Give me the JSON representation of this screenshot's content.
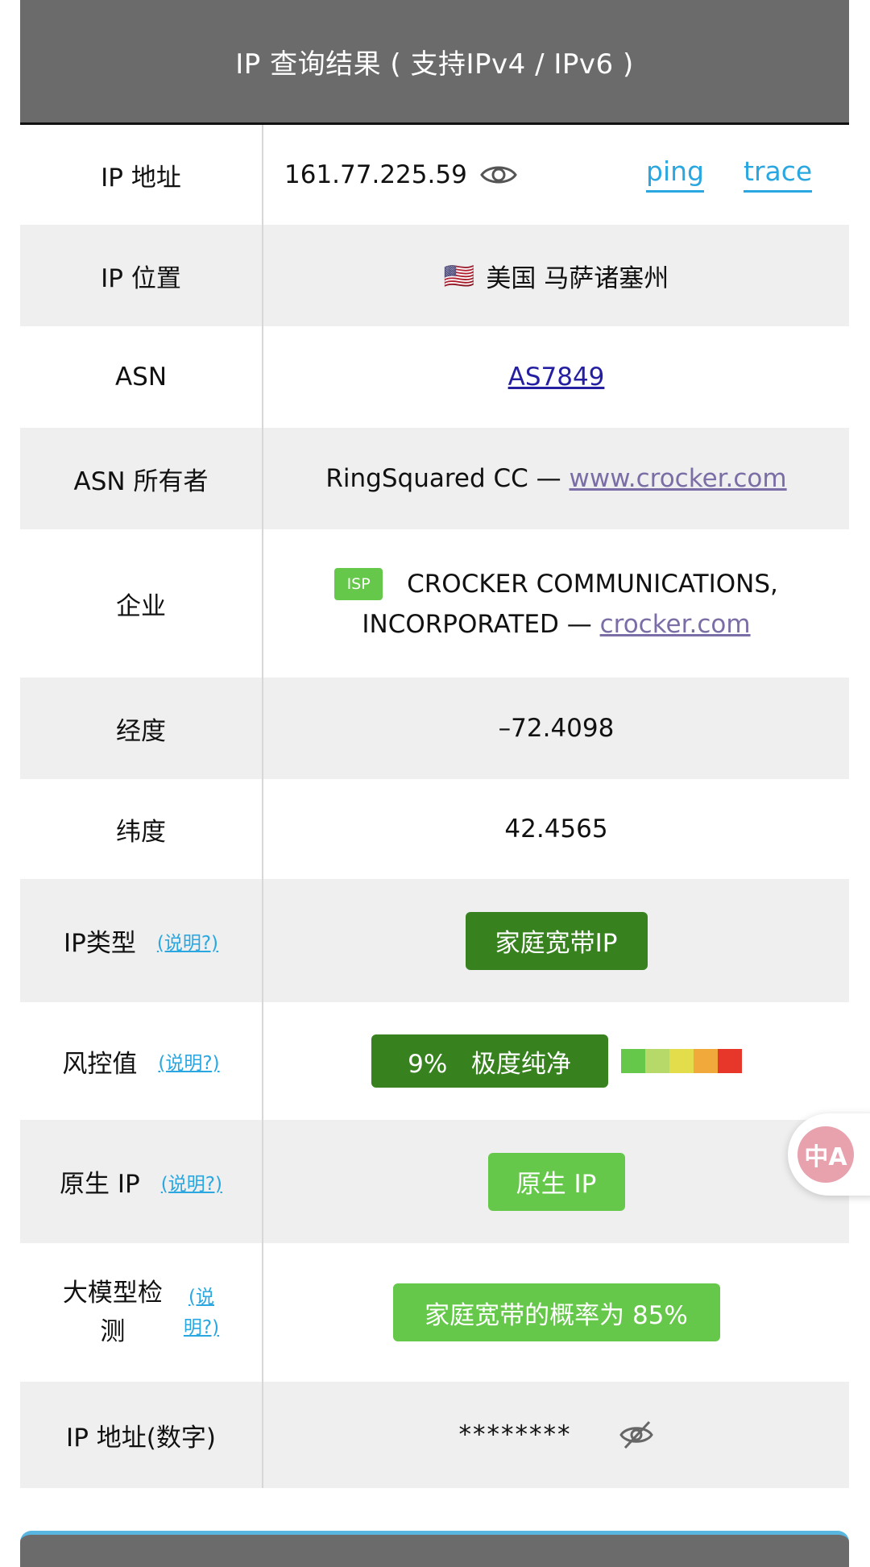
{
  "header": {
    "title": "IP 查询结果 ( 支持IPv4 / IPv6 )"
  },
  "rows": {
    "ip": {
      "label": "IP 地址",
      "value": "161.77.225.59",
      "ping": "ping",
      "trace": "trace"
    },
    "location": {
      "label": "IP 位置",
      "flag": "🇺🇸",
      "value": "美国 马萨诸塞州"
    },
    "asn": {
      "label": "ASN",
      "value": "AS7849"
    },
    "asn_owner": {
      "label": "ASN 所有者",
      "name": "RingSquared CC — ",
      "link": "www.crocker.com"
    },
    "company": {
      "label": "企业",
      "badge": "ISP",
      "line1": "CROCKER COMMUNICATIONS,",
      "line2": "INCORPORATED — ",
      "link": "crocker.com"
    },
    "longitude": {
      "label": "经度",
      "value": "–72.4098"
    },
    "latitude": {
      "label": "纬度",
      "value": "42.4565"
    },
    "ip_type": {
      "label": "IP类型",
      "help": "(说明?)",
      "badge": "家庭宽带IP"
    },
    "risk": {
      "label": "风控值",
      "help": "(说明?)",
      "badge": "9%   极度纯净",
      "scale_colors": [
        "#66c84a",
        "#b6d96a",
        "#e3dc4b",
        "#f2a93b",
        "#e6372a"
      ]
    },
    "native": {
      "label": "原生 IP",
      "help": "(说明?)",
      "badge": "原生 IP"
    },
    "llm": {
      "label_line1": "大模型检",
      "label_line2": "测",
      "help_line1": "(说",
      "help_line2": "明?)",
      "badge": "家庭宽带的概率为 85%"
    },
    "ip_numeric": {
      "label": "IP 地址(数字)",
      "value": "********"
    }
  },
  "icons": {
    "eye": "eye-icon",
    "eye_off": "eye-off-icon",
    "translate": "translate-icon"
  },
  "translate": {
    "glyph": "中A"
  }
}
